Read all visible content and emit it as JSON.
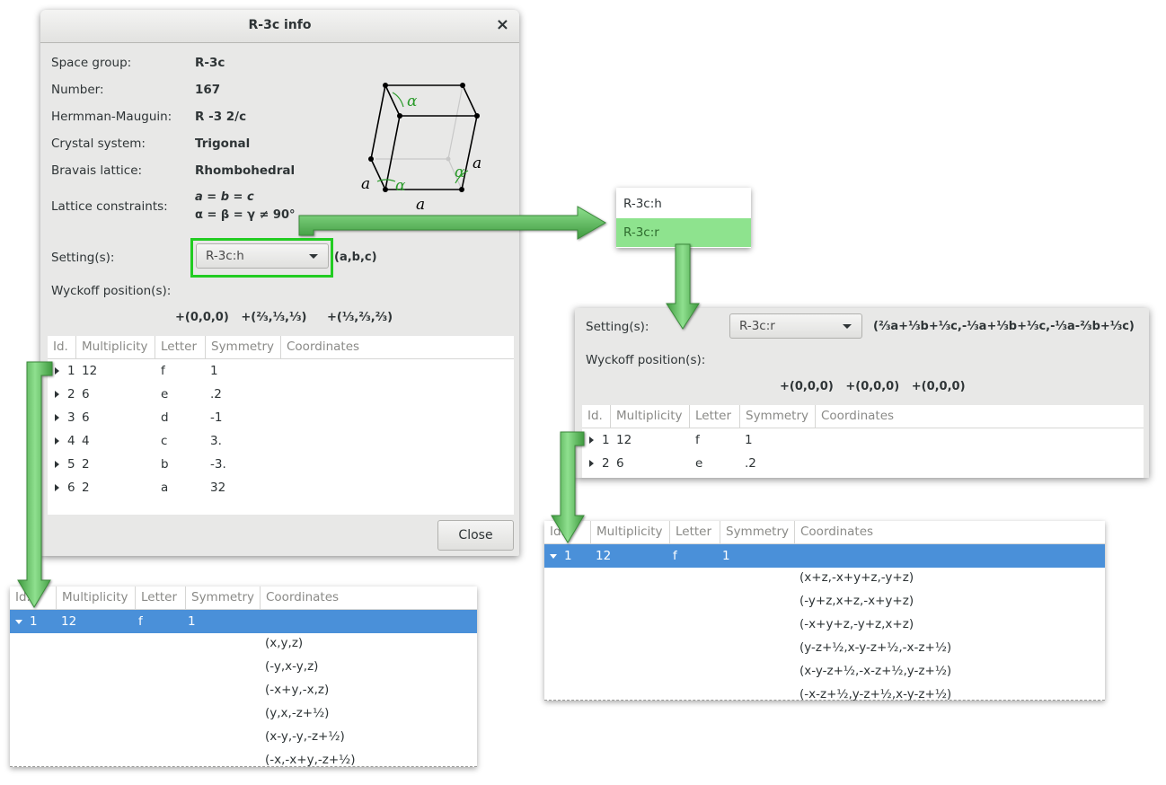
{
  "dialog": {
    "title": "R-3c info",
    "close_icon": "×",
    "space_group_label": "Space group:",
    "space_group": "R-3c",
    "number_label": "Number:",
    "number": "167",
    "hm_label": "Hermman-Mauguin:",
    "hm": "R -3 2/c",
    "crystal_label": "Crystal system:",
    "crystal": "Trigonal",
    "bravais_label": "Bravais lattice:",
    "bravais": "Rhombohedral",
    "constraints_label": "Lattice constraints:",
    "constraint_1": "a = b = c",
    "constraint_2": "α = β = γ ≠ 90°",
    "setting_label": "Setting(s):",
    "setting_value": "R-3c:h",
    "setting_basis": "(a,b,c)",
    "wyckoff_label": "Wyckoff position(s):",
    "translations": "+(0,0,0)   +(⅔,⅓,⅓)     +(⅓,⅔,⅔)",
    "close_button": "Close",
    "diagram": {
      "alpha": "α",
      "a": "a"
    },
    "table": {
      "headers": [
        "Id.",
        "Multiplicity",
        "Letter",
        "Symmetry",
        "Coordinates"
      ],
      "rows": [
        {
          "id": "1",
          "mult": "12",
          "letter": "f",
          "sym": "1"
        },
        {
          "id": "2",
          "mult": "6",
          "letter": "e",
          "sym": ".2"
        },
        {
          "id": "3",
          "mult": "6",
          "letter": "d",
          "sym": "-1"
        },
        {
          "id": "4",
          "mult": "4",
          "letter": "c",
          "sym": "3."
        },
        {
          "id": "5",
          "mult": "2",
          "letter": "b",
          "sym": "-3."
        },
        {
          "id": "6",
          "mult": "2",
          "letter": "a",
          "sym": "32"
        }
      ]
    }
  },
  "dropdown": {
    "items": [
      "R-3c:h",
      "R-3c:r"
    ],
    "highlighted_index": 1
  },
  "right_panel": {
    "setting_label": "Setting(s):",
    "setting_value": "R-3c:r",
    "setting_basis": "(⅔a+⅓b+⅓c,-⅓a+⅓b+⅓c,-⅓a-⅔b+⅓c)",
    "wyckoff_label": "Wyckoff position(s):",
    "translations": "+(0,0,0)   +(0,0,0)   +(0,0,0)",
    "table": {
      "headers": [
        "Id.",
        "Multiplicity",
        "Letter",
        "Symmetry",
        "Coordinates"
      ],
      "rows": [
        {
          "id": "1",
          "mult": "12",
          "letter": "f",
          "sym": "1"
        },
        {
          "id": "2",
          "mult": "6",
          "letter": "e",
          "sym": ".2"
        }
      ]
    }
  },
  "expanded_left": {
    "headers": [
      "Id.",
      "Multiplicity",
      "Letter",
      "Symmetry",
      "Coordinates"
    ],
    "row": {
      "id": "1",
      "mult": "12",
      "letter": "f",
      "sym": "1"
    },
    "coords": [
      "(x,y,z)",
      "(-y,x-y,z)",
      "(-x+y,-x,z)",
      "(y,x,-z+½)",
      "(x-y,-y,-z+½)",
      "(-x,-x+y,-z+½)"
    ]
  },
  "expanded_right": {
    "headers": [
      "Id.",
      "Multiplicity",
      "Letter",
      "Symmetry",
      "Coordinates"
    ],
    "row": {
      "id": "1",
      "mult": "12",
      "letter": "f",
      "sym": "1"
    },
    "coords": [
      "(x+z,-x+y+z,-y+z)",
      "(-y+z,x+z,-x+y+z)",
      "(-x+y+z,-y+z,x+z)",
      "(y-z+½,x-y-z+½,-x-z+½)",
      "(x-y-z+½,-x-z+½,y-z+½)",
      "(-x-z+½,y-z+½,x-y-z+½)"
    ]
  },
  "colors": {
    "highlight_green": "#22cc22",
    "selection_blue": "#4a90d9",
    "menu_green": "#8ee38e",
    "arrow_green": "#5cb85c"
  }
}
